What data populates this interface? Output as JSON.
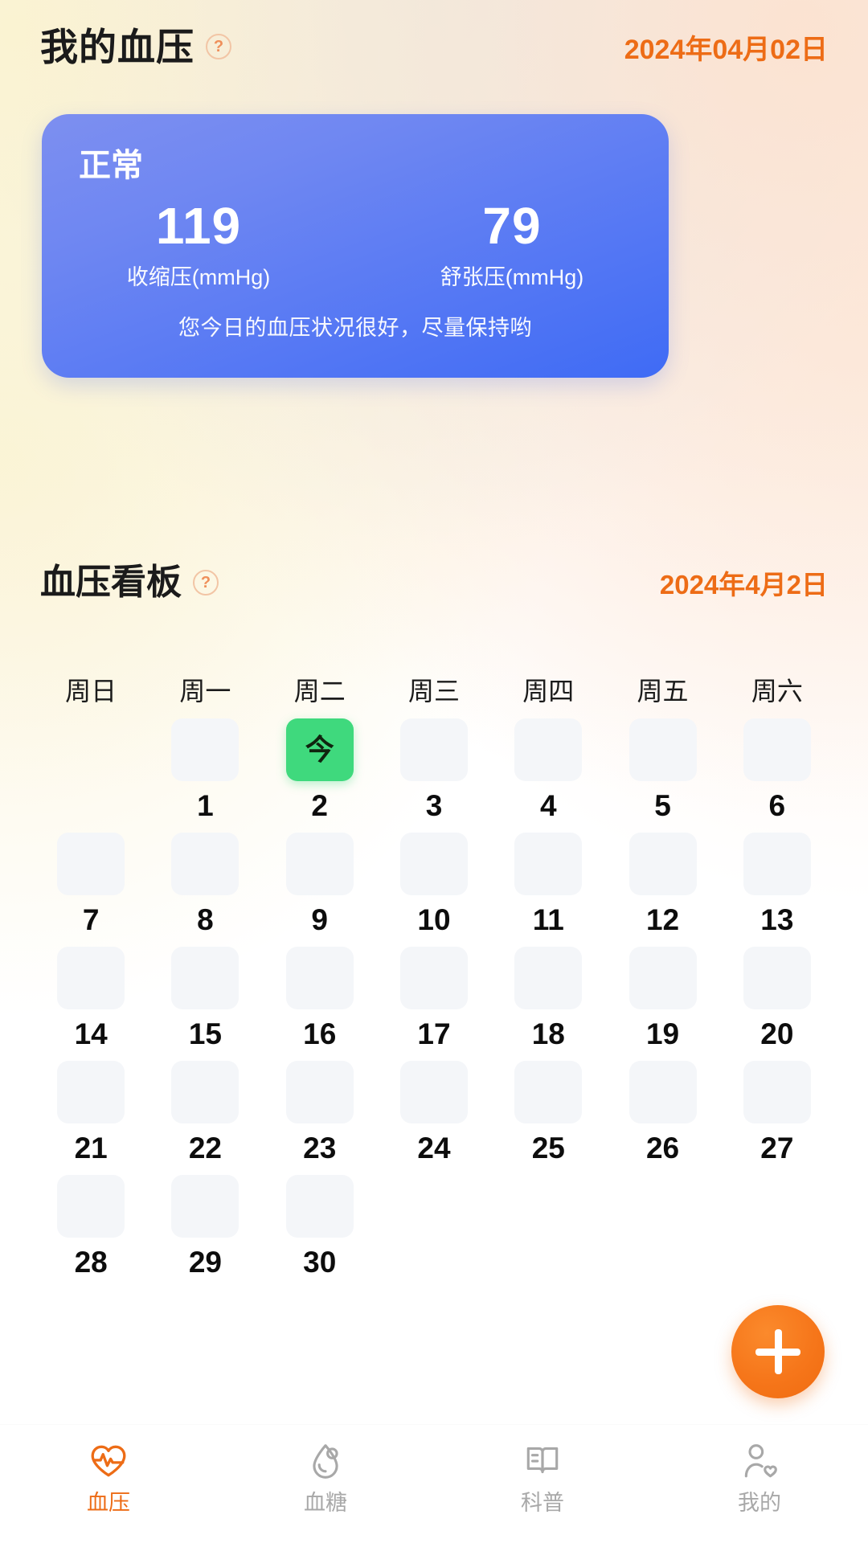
{
  "header": {
    "title": "我的血压",
    "help_icon": "question-circle-icon",
    "help_glyph": "?",
    "date": "2024年04月02日"
  },
  "summary_card": {
    "status": "正常",
    "systolic": {
      "value": "119",
      "label": "收缩压(mmHg)"
    },
    "diastolic": {
      "value": "79",
      "label": "舒张压(mmHg)"
    },
    "note": "您今日的血压状况很好，尽量保持哟",
    "accent_color": "#3f6bf5"
  },
  "board": {
    "title": "血压看板",
    "help_icon": "question-circle-icon",
    "help_glyph": "?",
    "date": "2024年4月2日"
  },
  "calendar": {
    "weekdays": [
      "周日",
      "周一",
      "周二",
      "周三",
      "周四",
      "周五",
      "周六"
    ],
    "today_marker": "今",
    "today_color": "#3fd97d",
    "empty_cell_color": "#f4f6f9",
    "weeks": [
      [
        {
          "day": "",
          "blank": true,
          "today": false
        },
        {
          "day": "1",
          "blank": false,
          "today": false
        },
        {
          "day": "2",
          "blank": false,
          "today": true
        },
        {
          "day": "3",
          "blank": false,
          "today": false
        },
        {
          "day": "4",
          "blank": false,
          "today": false
        },
        {
          "day": "5",
          "blank": false,
          "today": false
        },
        {
          "day": "6",
          "blank": false,
          "today": false
        }
      ],
      [
        {
          "day": "7",
          "blank": false,
          "today": false
        },
        {
          "day": "8",
          "blank": false,
          "today": false
        },
        {
          "day": "9",
          "blank": false,
          "today": false
        },
        {
          "day": "10",
          "blank": false,
          "today": false
        },
        {
          "day": "11",
          "blank": false,
          "today": false
        },
        {
          "day": "12",
          "blank": false,
          "today": false
        },
        {
          "day": "13",
          "blank": false,
          "today": false
        }
      ],
      [
        {
          "day": "14",
          "blank": false,
          "today": false
        },
        {
          "day": "15",
          "blank": false,
          "today": false
        },
        {
          "day": "16",
          "blank": false,
          "today": false
        },
        {
          "day": "17",
          "blank": false,
          "today": false
        },
        {
          "day": "18",
          "blank": false,
          "today": false
        },
        {
          "day": "19",
          "blank": false,
          "today": false
        },
        {
          "day": "20",
          "blank": false,
          "today": false
        }
      ],
      [
        {
          "day": "21",
          "blank": false,
          "today": false
        },
        {
          "day": "22",
          "blank": false,
          "today": false
        },
        {
          "day": "23",
          "blank": false,
          "today": false
        },
        {
          "day": "24",
          "blank": false,
          "today": false
        },
        {
          "day": "25",
          "blank": false,
          "today": false
        },
        {
          "day": "26",
          "blank": false,
          "today": false
        },
        {
          "day": "27",
          "blank": false,
          "today": false
        }
      ],
      [
        {
          "day": "28",
          "blank": false,
          "today": false
        },
        {
          "day": "29",
          "blank": false,
          "today": false
        },
        {
          "day": "30",
          "blank": false,
          "today": false
        },
        {
          "day": "",
          "blank": true,
          "today": false
        },
        {
          "day": "",
          "blank": true,
          "today": false
        },
        {
          "day": "",
          "blank": true,
          "today": false
        },
        {
          "day": "",
          "blank": true,
          "today": false
        }
      ]
    ]
  },
  "fab": {
    "icon": "plus-icon",
    "label": "",
    "color": "#f6761a"
  },
  "bottom_nav": {
    "active_color": "#ed6c16",
    "inactive_color": "#a8a8a8",
    "items": [
      {
        "label": "血压",
        "icon": "heart-pulse-icon",
        "active": true
      },
      {
        "label": "血糖",
        "icon": "blood-drop-icon",
        "active": false
      },
      {
        "label": "科普",
        "icon": "open-book-icon",
        "active": false
      },
      {
        "label": "我的",
        "icon": "person-heart-icon",
        "active": false
      }
    ]
  }
}
